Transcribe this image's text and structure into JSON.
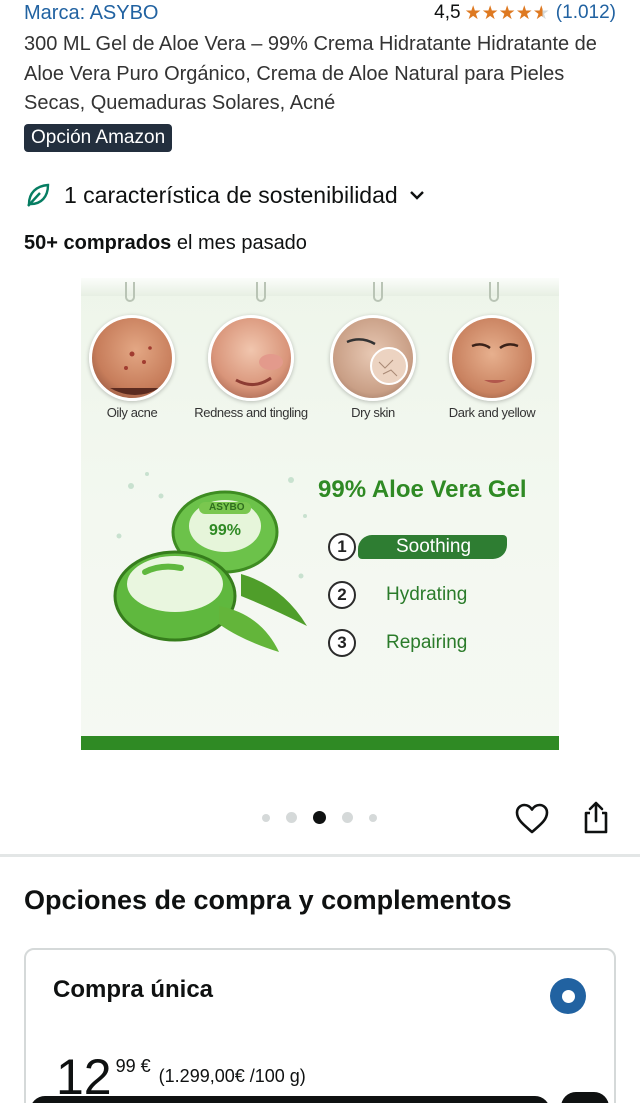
{
  "brand": {
    "label": "Marca: ASYBO"
  },
  "rating": {
    "score": "4,5",
    "stars": 4.5,
    "count": "(1.012)"
  },
  "title": "300 ML Gel de Aloe Vera – 99% Crema Hidratante Hidratante de Aloe Vera Puro Orgánico, Crema de Aloe Natural para Pieles Secas, Quemaduras Solares, Acné",
  "badge": "Opción Amazon",
  "sustainability": {
    "label": "1 característica de sostenibilidad",
    "icon": "leaf-icon"
  },
  "bought": {
    "bold": "50+ comprados",
    "rest": " el mes pasado"
  },
  "image": {
    "faces": [
      {
        "label": "Oily acne"
      },
      {
        "label": "Redness and tingling"
      },
      {
        "label": "Dry skin"
      },
      {
        "label": "Dark and yellow"
      }
    ],
    "jar_brand": "ASYBO",
    "jar_percent": "99%",
    "headline": "99% Aloe Vera Gel",
    "benefits": [
      {
        "num": "1",
        "label": "Soothing"
      },
      {
        "num": "2",
        "label": "Hydrating"
      },
      {
        "num": "3",
        "label": "Repairing"
      }
    ]
  },
  "carousel": {
    "total": 5,
    "active_index": 2
  },
  "actions": {
    "favorite_icon": "heart-icon",
    "share_icon": "share-icon"
  },
  "section_title": "Opciones de compra y complementos",
  "purchase": {
    "title": "Compra única",
    "price_whole": "12",
    "price_fraction": "99 €",
    "unit_price": "(1.299,00€ /100 g)"
  },
  "colors": {
    "link": "#2162a1",
    "star": "#de7921",
    "badge": "#232f3e",
    "brand_green": "#2f8a24"
  }
}
